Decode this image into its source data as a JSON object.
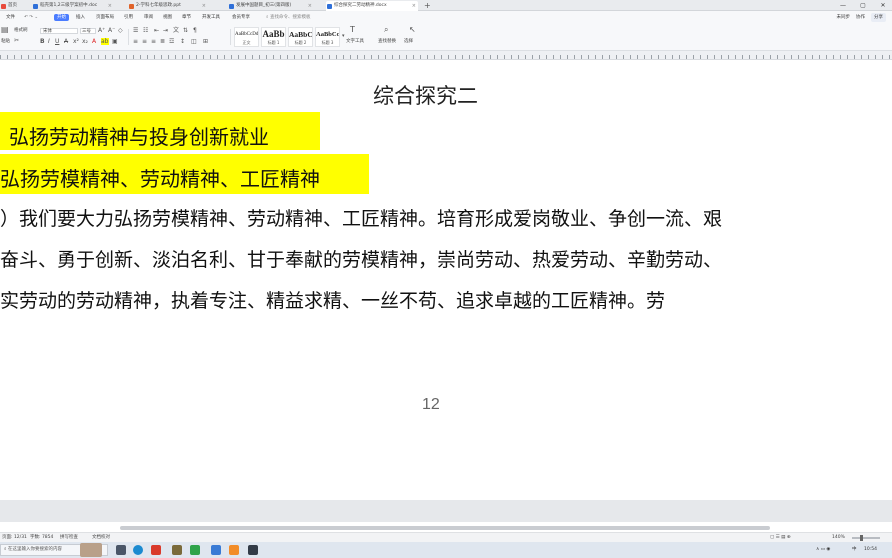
{
  "tabs": [
    {
      "label": "首页",
      "color": "#e84a3c",
      "active": false
    },
    {
      "label": "稻壳第1,2三级学案初中.doc",
      "color": "#2e6fd8",
      "active": false
    },
    {
      "label": "2-学科七年级思政.ppt",
      "color": "#e0632a",
      "active": false
    },
    {
      "label": "发展中国题目_初三(第四版)",
      "color": "#2e6fd8",
      "active": false
    },
    {
      "label": "综合探究二劳动精神.docx",
      "color": "#2e6fd8",
      "active": true
    }
  ],
  "window": {
    "minimize": "—",
    "maximize": "▢",
    "close": "✕"
  },
  "menu": {
    "items": [
      "文件",
      "开始",
      "插入",
      "页面布局",
      "引用",
      "审阅",
      "视图",
      "章节",
      "开发工具",
      "会员专享"
    ],
    "active_index": 1,
    "search": "查找命令、搜索模板",
    "right": {
      "sync": "未同步",
      "collab": "协作",
      "share": "分享"
    }
  },
  "ribbon": {
    "paste": "粘贴",
    "format_painter": "格式刷",
    "font_name": "宋体",
    "font_size": "三号",
    "styles": [
      {
        "sample": "AaBbCcDd",
        "label": "正文"
      },
      {
        "sample": "AaBb",
        "label": "标题 1"
      },
      {
        "sample": "AaBbC",
        "label": "标题 2"
      },
      {
        "sample": "AaBbCc",
        "label": "标题 3"
      }
    ],
    "text_tools": "文字工具",
    "find_replace": "查找替换",
    "select": "选择"
  },
  "document": {
    "title": "综合探究二",
    "heading": "弘扬劳动精神与投身创新就业",
    "subheading": "弘扬劳模精神、劳动精神、工匠精神",
    "body_lines": [
      "）我们要大力弘扬劳模精神、劳动精神、工匠精神。培育形成爱岗敬业、争创一流、艰",
      "奋斗、勇于创新、淡泊名利、甘于奉献的劳模精神，崇尚劳动、热爱劳动、辛勤劳动、",
      "实劳动的劳动精神，执着专注、精益求精、一丝不苟、追求卓越的工匠精神。劳"
    ],
    "page_number": "12"
  },
  "status": {
    "page": "页面: 12/31",
    "words": "字数: 7854",
    "spell": "拼写检查",
    "doc_check": "文档校对",
    "zoom": "140%"
  },
  "taskbar": {
    "search_placeholder": "在这里输入你要搜索的内容",
    "tray_lang": "中",
    "tray_time": "10:54"
  }
}
